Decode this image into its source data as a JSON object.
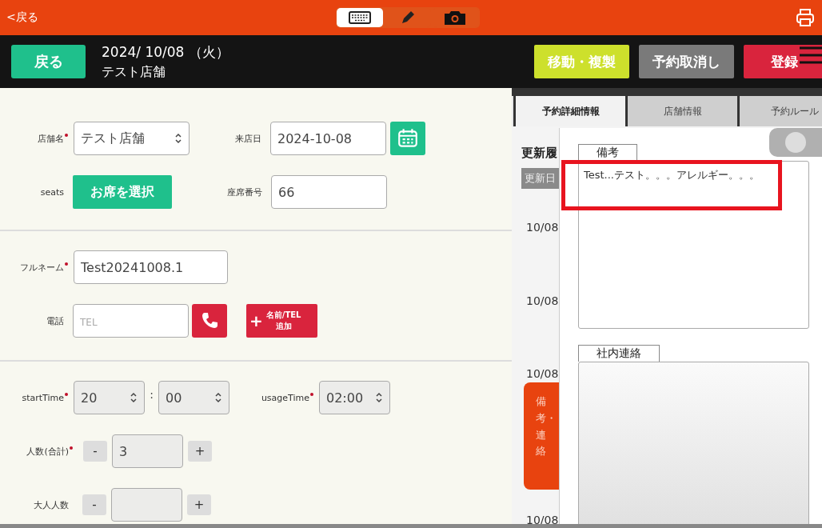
{
  "topbar": {
    "back": "<戻る",
    "modes": [
      {
        "kind": "keyboard",
        "selected": true
      },
      {
        "kind": "pen",
        "selected": false
      },
      {
        "kind": "camera",
        "selected": false
      }
    ]
  },
  "header": {
    "back_button": "戻る",
    "date": "2024/ 10/08 （火）",
    "store": "テスト店舗",
    "actions": [
      {
        "label": "移動・複製",
        "kind": "move"
      },
      {
        "label": "予約取消し",
        "kind": "cancel"
      },
      {
        "label": "登録",
        "kind": "register"
      }
    ]
  },
  "form": {
    "store": {
      "label": "店舗名",
      "required": true,
      "value": "テスト店舗"
    },
    "visit_date": {
      "label": "来店日",
      "value": "2024-10-08"
    },
    "seats": {
      "label": "seats",
      "button": "お席を選択"
    },
    "seat_number": {
      "label": "座席番号",
      "value": "66"
    },
    "full_name": {
      "label": "フルネーム",
      "required": true,
      "value": "Test20241008.1"
    },
    "phone": {
      "label": "電話",
      "placeholder": "TEL",
      "add_button_lines": [
        "名前/TEL",
        "追加"
      ],
      "add_icon": "+"
    },
    "start_time": {
      "label": "startTime",
      "required": true,
      "hour": "20",
      "separator": ":",
      "minute": "00"
    },
    "usage_time": {
      "label": "usageTime",
      "required": true,
      "value": "02:00"
    },
    "counters": [
      {
        "label": "人数(合計)",
        "required": true,
        "value": "3",
        "minus": "-",
        "plus": "+"
      },
      {
        "label": "大人人数",
        "required": false,
        "minus": "-",
        "plus": "+"
      }
    ]
  },
  "tabs": [
    {
      "label": "予約詳細情報",
      "selected": true
    },
    {
      "label": "店舗情報",
      "selected": false
    },
    {
      "label": "予約ルール",
      "selected": false
    }
  ],
  "history": {
    "title": "更新履",
    "column": "更新日",
    "rows": [
      "10/08",
      "10/08",
      "10/08",
      "10/08"
    ]
  },
  "side_tab": "備考・連絡",
  "memo_fields": [
    {
      "label": "備考",
      "value": "Test...テスト。。。アレルギー。。。"
    },
    {
      "label": "社内連絡"
    }
  ]
}
